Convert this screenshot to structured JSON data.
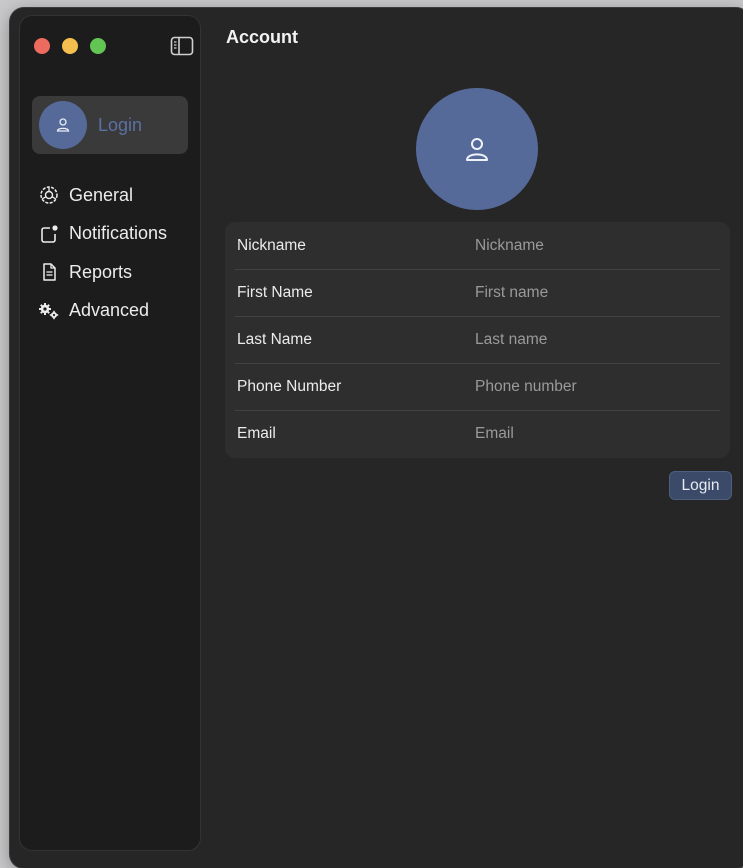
{
  "window": {
    "title": "Account"
  },
  "sidebar": {
    "login_label": "Login",
    "items": [
      {
        "label": "General",
        "icon": "gear-badge-icon"
      },
      {
        "label": "Notifications",
        "icon": "notification-icon"
      },
      {
        "label": "Reports",
        "icon": "document-icon"
      },
      {
        "label": "Advanced",
        "icon": "gears-icon"
      }
    ]
  },
  "form": {
    "rows": [
      {
        "label": "Nickname",
        "placeholder": "Nickname"
      },
      {
        "label": "First Name",
        "placeholder": "First name"
      },
      {
        "label": "Last Name",
        "placeholder": "Last name"
      },
      {
        "label": "Phone Number",
        "placeholder": "Phone number"
      },
      {
        "label": "Email",
        "placeholder": "Email"
      }
    ]
  },
  "actions": {
    "login_label": "Login"
  },
  "colors": {
    "accent": "#566a9a",
    "window_bg": "#262626",
    "sidebar_bg": "#1c1c1c"
  }
}
